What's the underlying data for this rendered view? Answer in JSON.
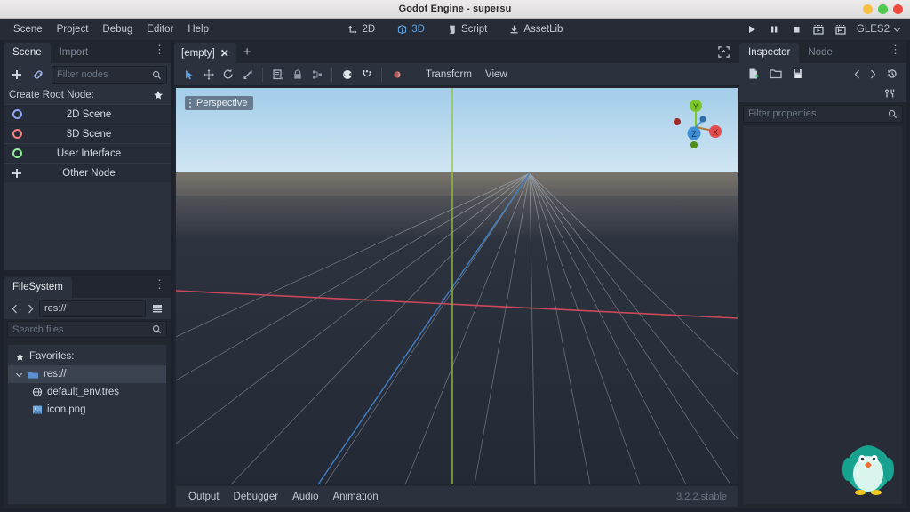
{
  "window": {
    "title": "Godot Engine - supersu",
    "controls": [
      "minimize",
      "maximize",
      "close"
    ]
  },
  "menubar": {
    "items": [
      {
        "label": "Scene",
        "name": "menu-scene"
      },
      {
        "label": "Project",
        "name": "menu-project"
      },
      {
        "label": "Debug",
        "name": "menu-debug"
      },
      {
        "label": "Editor",
        "name": "menu-editor"
      },
      {
        "label": "Help",
        "name": "menu-help"
      }
    ]
  },
  "main_tabs": [
    {
      "label": "2D",
      "icon": "2d-icon",
      "active": false
    },
    {
      "label": "3D",
      "icon": "3d-icon",
      "active": true
    },
    {
      "label": "Script",
      "icon": "script-icon",
      "active": false
    },
    {
      "label": "AssetLib",
      "icon": "assetlib-icon",
      "active": false
    }
  ],
  "playback": {
    "buttons": [
      {
        "name": "play-button",
        "icon": "play-icon"
      },
      {
        "name": "pause-button",
        "icon": "pause-icon"
      },
      {
        "name": "stop-button",
        "icon": "stop-icon"
      },
      {
        "name": "play-scene-button",
        "icon": "play-scene-icon"
      },
      {
        "name": "play-custom-scene-button",
        "icon": "play-custom-icon"
      }
    ],
    "renderer": "GLES2"
  },
  "scene_dock": {
    "tabs": [
      {
        "label": "Scene",
        "active": true
      },
      {
        "label": "Import",
        "active": false
      }
    ],
    "toolbar": {
      "add_icon": "plus-icon",
      "instance_icon": "link-icon",
      "filter_placeholder": "Filter nodes",
      "search_icon": "search-icon"
    },
    "create_root_node": {
      "label": "Create Root Node:",
      "favorite_icon": "star-icon",
      "options": [
        {
          "label": "2D Scene",
          "icon": "node2d-icon",
          "color": "#8da5f3"
        },
        {
          "label": "3D Scene",
          "icon": "spatial-icon",
          "color": "#fc7f7f"
        },
        {
          "label": "User Interface",
          "icon": "control-icon",
          "color": "#8eef97"
        },
        {
          "label": "Other Node",
          "icon": "plus-icon",
          "color": "#e0e4eb"
        }
      ]
    }
  },
  "filesystem_dock": {
    "title": "FileSystem",
    "nav": {
      "back_icon": "chevron-left-icon",
      "forward_icon": "chevron-right-icon",
      "path": "res://",
      "layout_icon": "split-mode-icon"
    },
    "search_placeholder": "Search files",
    "search_icon": "search-icon",
    "tree": [
      {
        "label": "Favorites:",
        "icon": "star-icon",
        "indent": 0,
        "selected": false
      },
      {
        "label": "res://",
        "icon": "folder-icon",
        "indent": 0,
        "selected": true,
        "expand_icon": "chevron-down-icon"
      },
      {
        "label": "default_env.tres",
        "icon": "environment-icon",
        "indent": 1,
        "selected": false
      },
      {
        "label": "icon.png",
        "icon": "image-icon",
        "indent": 1,
        "selected": false
      }
    ]
  },
  "viewport": {
    "scene_tab": {
      "label": "[empty]",
      "close_icon": "close-icon"
    },
    "new_tab_icon": "plus-icon",
    "maximize_icon": "fullscreen-icon",
    "toolbar": {
      "tools": [
        {
          "name": "select-mode-button",
          "icon": "cursor-icon",
          "active": true
        },
        {
          "name": "move-mode-button",
          "icon": "move-icon",
          "active": false
        },
        {
          "name": "rotate-mode-button",
          "icon": "rotate-icon",
          "active": false
        },
        {
          "name": "scale-mode-button",
          "icon": "scale-icon",
          "active": false
        },
        {
          "name": "list-select-button",
          "icon": "list-select-icon",
          "active": false
        },
        {
          "name": "lock-button",
          "icon": "lock-icon",
          "active": false
        },
        {
          "name": "group-button",
          "icon": "group-icon",
          "active": false
        },
        {
          "name": "local-space-button",
          "icon": "globe-icon",
          "active": false
        },
        {
          "name": "snap-button",
          "icon": "snap-icon",
          "active": false
        },
        {
          "name": "preview-sun-button",
          "icon": "sphere-icon",
          "active": false
        }
      ],
      "menus": [
        {
          "label": "Transform",
          "name": "transform-menu"
        },
        {
          "label": "View",
          "name": "view-menu"
        }
      ]
    },
    "label": "Perspective",
    "gizmo": {
      "axes": [
        {
          "label": "X",
          "color": "#e34d4d"
        },
        {
          "label": "Y",
          "color": "#7bc62b"
        },
        {
          "label": "Z",
          "color": "#3e8fd6"
        }
      ]
    },
    "colors": {
      "sky_top": "#a4cfea",
      "sky_bottom": "#cfe4f2",
      "ground": "#232a36",
      "x_axis": "#d44a5e",
      "y_axis": "#93c530",
      "z_axis": "#3f7fc4"
    }
  },
  "bottom_panel": {
    "items": [
      {
        "label": "Output",
        "name": "output-tab"
      },
      {
        "label": "Debugger",
        "name": "debugger-tab"
      },
      {
        "label": "Audio",
        "name": "audio-tab"
      },
      {
        "label": "Animation",
        "name": "animation-tab"
      }
    ],
    "version": "3.2.2.stable"
  },
  "inspector_dock": {
    "tabs": [
      {
        "label": "Inspector",
        "active": true
      },
      {
        "label": "Node",
        "active": false
      }
    ],
    "tools": [
      {
        "name": "new-resource-button",
        "icon": "new-resource-icon"
      },
      {
        "name": "load-resource-button",
        "icon": "folder-open-icon"
      },
      {
        "name": "save-resource-button",
        "icon": "save-icon"
      },
      {
        "name": "history-back-button",
        "icon": "chevron-left-icon"
      },
      {
        "name": "history-forward-button",
        "icon": "chevron-right-icon"
      },
      {
        "name": "history-button",
        "icon": "history-icon"
      },
      {
        "name": "object-tools-button",
        "icon": "tools-icon"
      }
    ],
    "filter_placeholder": "Filter properties",
    "search_icon": "search-icon"
  },
  "mascot": {
    "name": "penguin-mascot",
    "body_color": "#1fae9a",
    "belly_color": "#d8f5ee",
    "beak_color": "#f06a2a",
    "feet_color": "#f2c61e"
  }
}
